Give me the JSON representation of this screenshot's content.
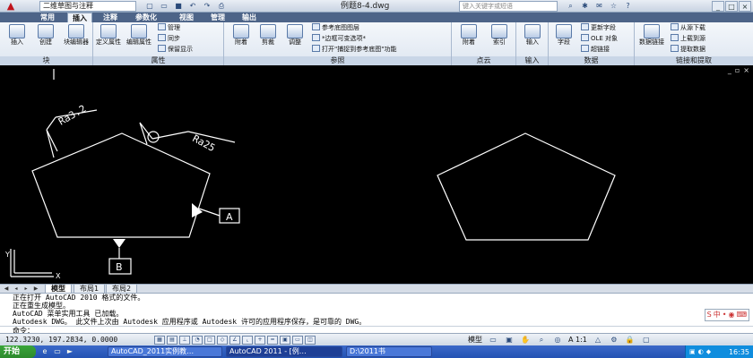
{
  "titlebar": {
    "workspace": "二维草图与注释",
    "document": "例题8-4.dwg",
    "search_placeholder": "键入关键字或短语",
    "qat_icons": [
      "new-icon",
      "open-icon",
      "save-icon",
      "undo-icon",
      "redo-icon",
      "plot-icon"
    ],
    "window_buttons": [
      "_",
      "□",
      "×"
    ]
  },
  "tabs": [
    "常用",
    "插入",
    "注释",
    "参数化",
    "视图",
    "管理",
    "输出"
  ],
  "active_tab": "插入",
  "ribbon": {
    "block_panel": {
      "title": "块",
      "buttons": [
        "插入",
        "创建",
        "块编辑器"
      ]
    },
    "attr_panel": {
      "title": "属性",
      "buttons": [
        "定义属性",
        "编辑属性"
      ],
      "small": [
        "管理",
        "同步",
        "保留显示"
      ]
    },
    "ref_panel": {
      "title": "参照",
      "buttons": [
        "附着",
        "剪裁",
        "调整"
      ],
      "small": [
        "参考底图图层",
        "*边框可变选项*",
        "打开\"捕捉到参考底图\"功能"
      ]
    },
    "pointcloud_panel": {
      "title": "点云",
      "buttons": [
        "附着",
        "索引"
      ]
    },
    "import_panel": {
      "title": "输入",
      "buttons": [
        "输入"
      ]
    },
    "data_panel": {
      "title": "数据",
      "buttons": [
        "字段"
      ],
      "small": [
        "更新字段",
        "OLE 对象",
        "超链接"
      ]
    },
    "link_panel": {
      "title": "链接和提取",
      "buttons": [
        "数据链接"
      ],
      "small": [
        "从源下载",
        "上载到源",
        "提取数据"
      ]
    }
  },
  "drawing": {
    "roughness_1": "Ra3.2",
    "roughness_2": "Ra25",
    "datum_a": "A",
    "datum_b": "B",
    "ucs_y": "Y",
    "ucs_x": "X"
  },
  "layout_tabs": [
    "模型",
    "布局1",
    "布局2"
  ],
  "command": {
    "history": [
      "正在打开 AutoCAD 2010 格式的文件。",
      "正在重生成模型。",
      "AutoCAD 菜单实用工具 已加载。",
      "Autodesk DWG。  此文件上次由 Autodesk 应用程序或 Autodesk 许可的应用程序保存，是可靠的 DWG。"
    ],
    "prompt": "命令："
  },
  "status": {
    "coordinates": "122.3230, 197.2834, 0.0000",
    "model_label": "模型",
    "scale": "A 1:1"
  },
  "taskbar": {
    "start": "开始",
    "tasks": [
      "AutoCAD_2011实例教…",
      "AutoCAD 2011 - [例…",
      "D:\\2011书"
    ],
    "clock": "16:35"
  },
  "colors": {
    "accent": "#4d6488",
    "canvas": "#000000",
    "geometry": "#ffffff"
  }
}
